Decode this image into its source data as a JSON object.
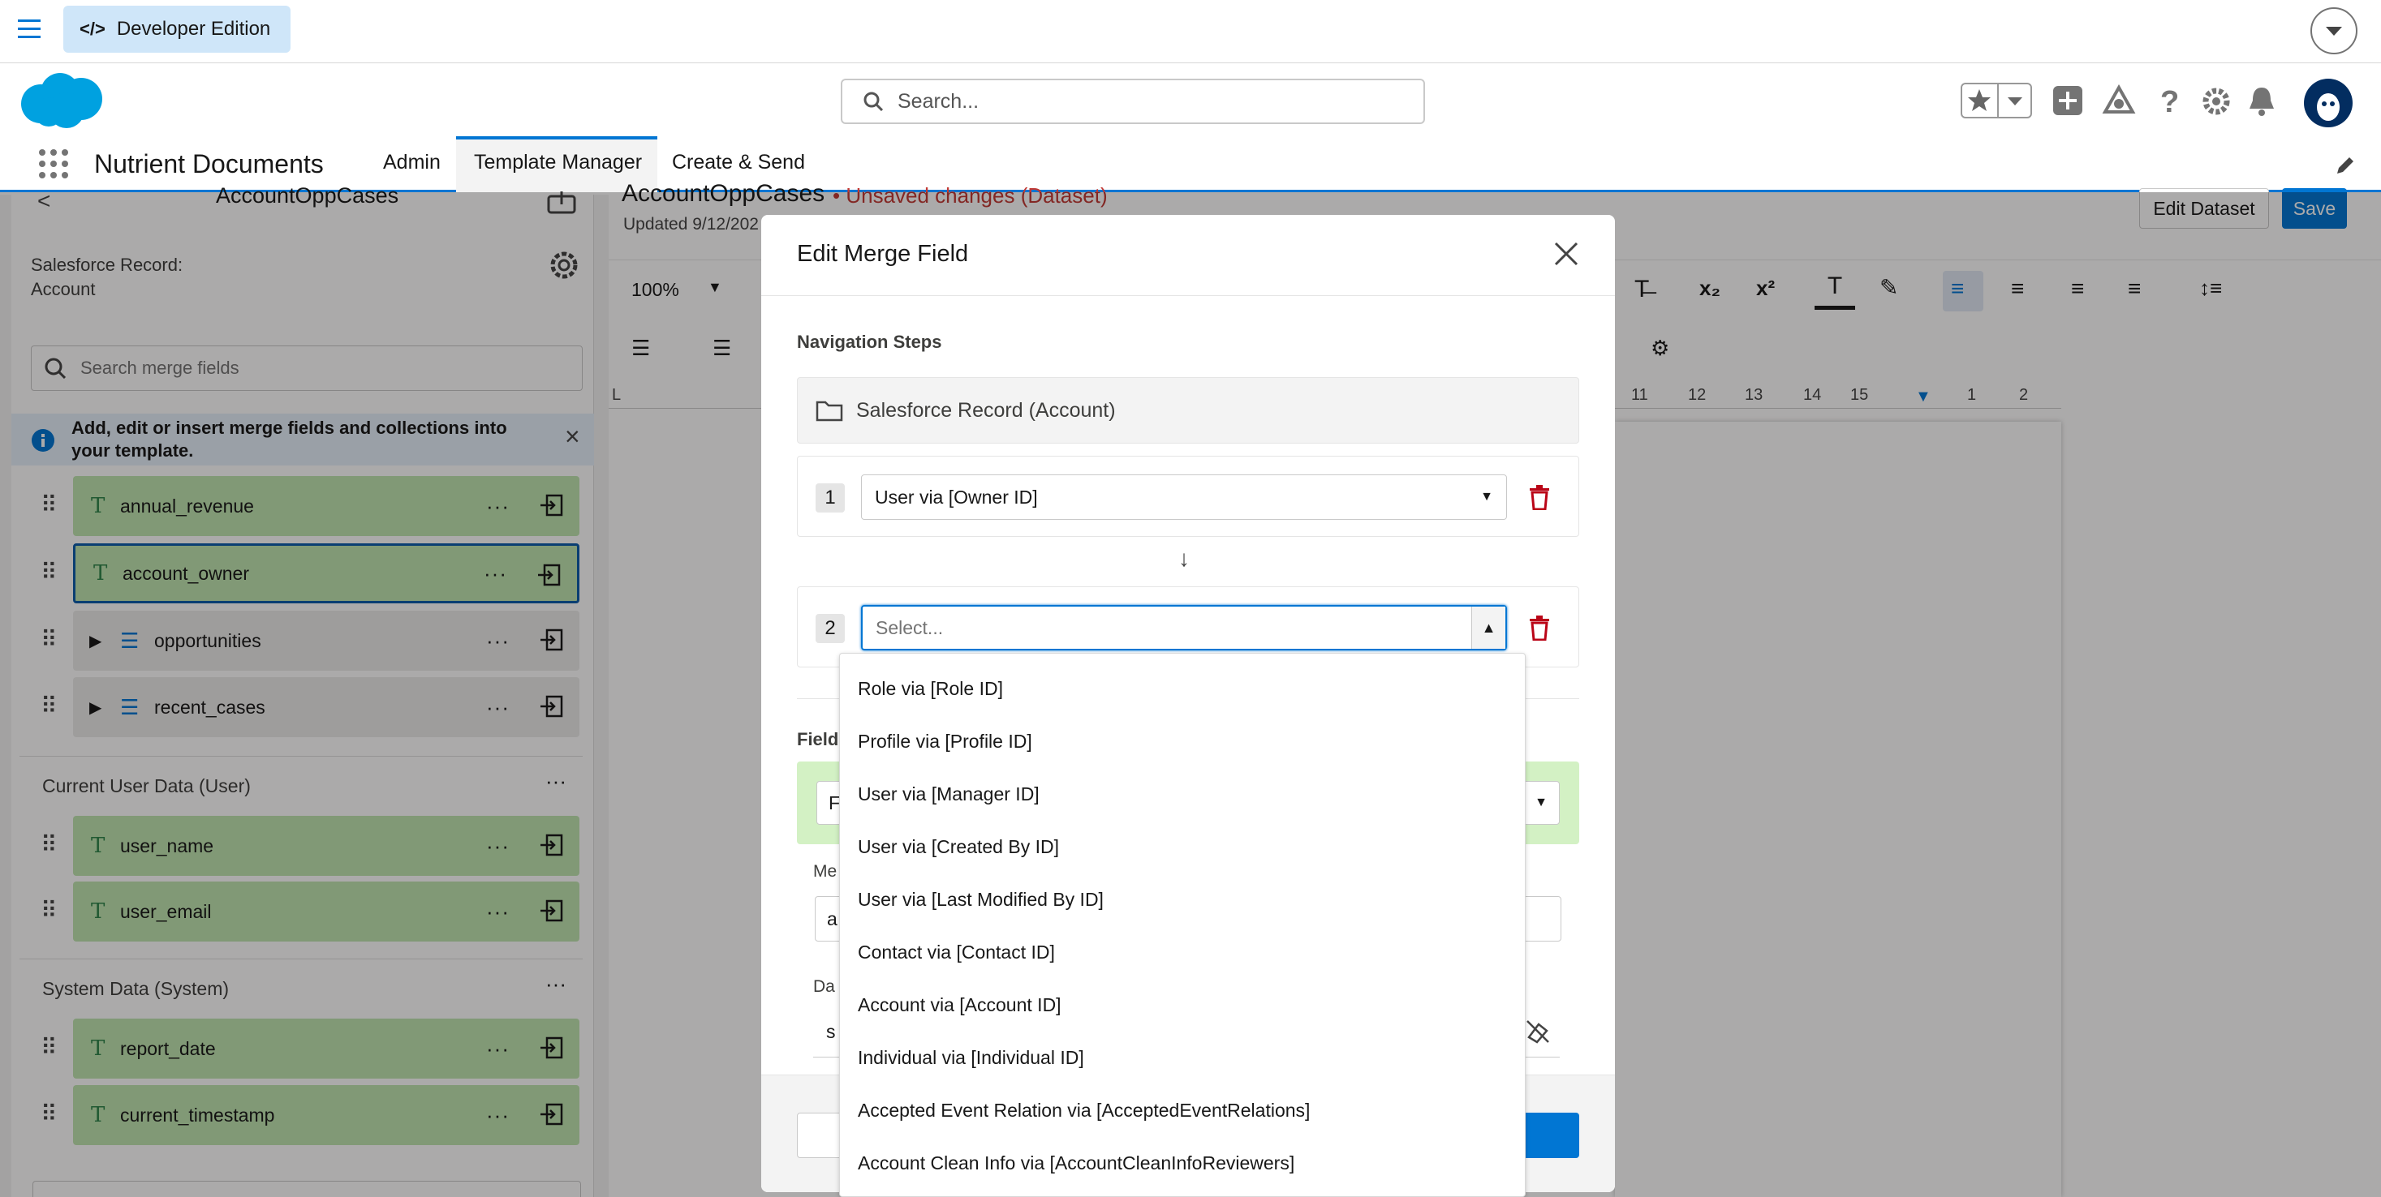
{
  "top_banner": {
    "edition": "Developer Edition"
  },
  "header": {
    "search_placeholder": "Search...",
    "app_name": "Nutrient Documents",
    "tabs": [
      {
        "label": "Admin"
      },
      {
        "label": "Template Manager",
        "active": true
      },
      {
        "label": "Create & Send"
      }
    ]
  },
  "sidebar": {
    "title": "AccountOppCases",
    "record_label": "Salesforce Record:",
    "record_value": "Account",
    "search_placeholder": "Search merge fields",
    "info_text": "Add, edit or insert merge fields and collections into your template.",
    "account_fields": [
      {
        "name": "annual_revenue",
        "type": "field"
      },
      {
        "name": "account_owner",
        "type": "field",
        "selected": true
      },
      {
        "name": "opportunities",
        "type": "collection"
      },
      {
        "name": "recent_cases",
        "type": "collection"
      }
    ],
    "user_section": {
      "title": "Current User Data (User)",
      "fields": [
        "user_name",
        "user_email"
      ]
    },
    "system_section": {
      "title": "System Data (System)",
      "fields": [
        "report_date",
        "current_timestamp"
      ]
    }
  },
  "editor": {
    "doc_title": "AccountOppCases",
    "unsaved": "• Unsaved changes (Dataset)",
    "updated": "Updated 9/12/202",
    "edit_dataset": "Edit Dataset",
    "save": "Save",
    "zoom": "100%",
    "ruler": [
      "L",
      "11",
      "12",
      "13",
      "14",
      "15",
      "1",
      "2"
    ]
  },
  "modal": {
    "title": "Edit Merge Field",
    "nav_steps_label": "Navigation Steps",
    "root_label": "Salesforce Record (Account)",
    "steps": [
      {
        "num": "1",
        "value": "User via [Owner ID]"
      },
      {
        "num": "2",
        "value": "",
        "placeholder": "Select..."
      }
    ],
    "field_label": "Field",
    "partial_1": "F",
    "merge_label": "Me",
    "partial_2": "a",
    "data_label": "Da",
    "partial_3": "s"
  },
  "dropdown_options": [
    "Role via [Role ID]",
    "Profile via [Profile ID]",
    "User via [Manager ID]",
    "User via [Created By ID]",
    "User via [Last Modified By ID]",
    "Contact via [Contact ID]",
    "Account via [Account ID]",
    "Individual via [Individual ID]",
    "Accepted Event Relation via [AcceptedEventRelations]",
    "Account Clean Info via [AccountCleanInfoReviewers]"
  ],
  "colors": {
    "brand": "#0176d3",
    "field_bg": "#bfe6b0",
    "danger": "#ba0517"
  }
}
